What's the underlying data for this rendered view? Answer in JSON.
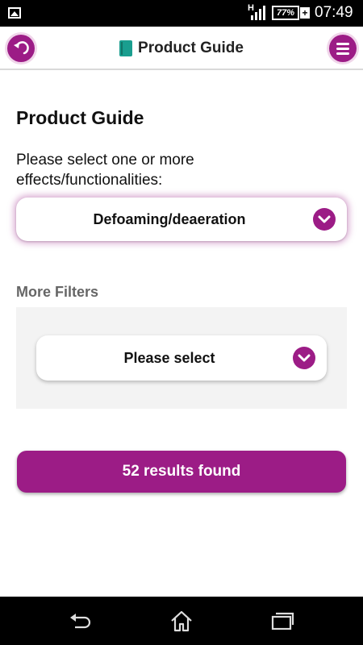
{
  "status_bar": {
    "network": "H",
    "battery": "77%",
    "time": "07:49"
  },
  "header": {
    "title": "Product Guide"
  },
  "main": {
    "heading": "Product Guide",
    "instructions": "Please select one or more effects/functionalities:",
    "effects_select": {
      "value": "Defoaming/deaeration"
    },
    "more_filters": {
      "title": "More Filters",
      "select": {
        "value": "Please select"
      }
    },
    "results_button": "52 results found"
  },
  "icons": {
    "back": "back-icon",
    "menu": "menu-icon",
    "book": "book-icon",
    "chevron": "chevron-down-icon"
  },
  "colors": {
    "accent": "#9c1c86",
    "book": "#1a9e8f"
  }
}
